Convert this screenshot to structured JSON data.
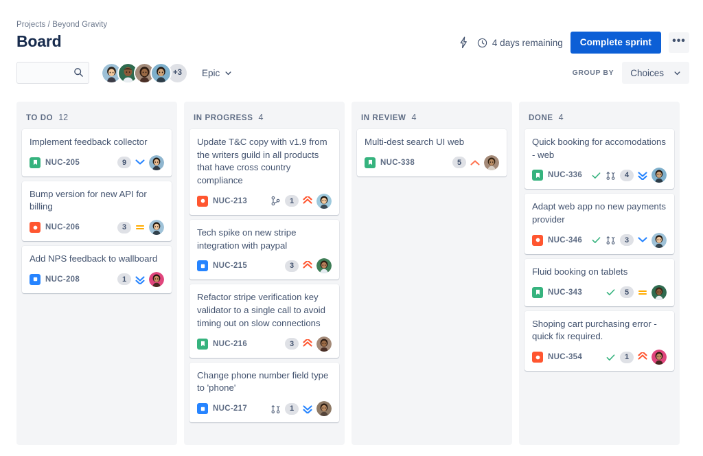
{
  "header": {
    "breadcrumb": "Projects / Beyond Gravity",
    "title": "Board",
    "lightning_icon": "lightning-bolt-icon",
    "clock_icon": "clock-icon",
    "days_remaining": "4 days remaining",
    "complete_sprint_label": "Complete sprint",
    "more_label": "•••"
  },
  "toolbar": {
    "search_placeholder": "",
    "search_value": "",
    "search_icon": "search-icon",
    "avatar_overflow": "+3",
    "epic_label": "Epic",
    "group_by_label": "GROUP BY",
    "group_by_value": "Choices"
  },
  "colors": {
    "primary": "#0c5fd6",
    "story": "#36b37e",
    "bug": "#ff5630",
    "task": "#2684ff",
    "priority_highest": "#ff5630",
    "priority_high": "#ff7452",
    "priority_medium": "#ffab00",
    "priority_low": "#2684ff",
    "priority_lowest": "#2684ff",
    "done_check": "#36b37e",
    "column_bg": "#f4f5f7"
  },
  "columns": [
    {
      "name": "TO DO",
      "count": "12",
      "cards": [
        {
          "title": "Implement feedback collector",
          "key": "NUC-205",
          "type": "story",
          "count": "9",
          "priority": "low",
          "dev": "",
          "done": false,
          "avatar": "a1"
        },
        {
          "title": "Bump version for new API for billing",
          "key": "NUC-206",
          "type": "bug",
          "count": "3",
          "priority": "medium",
          "dev": "",
          "done": false,
          "avatar": "a2"
        },
        {
          "title": "Add NPS feedback to wallboard",
          "key": "NUC-208",
          "type": "task",
          "count": "1",
          "priority": "lowest",
          "dev": "",
          "done": false,
          "avatar": "a3"
        }
      ]
    },
    {
      "name": "IN PROGRESS",
      "count": "4",
      "cards": [
        {
          "title": "Update T&C copy with v1.9 from the writers guild in all products that have cross country compliance",
          "key": "NUC-213",
          "type": "bug",
          "count": "1",
          "priority": "highest",
          "dev": "branch",
          "done": false,
          "avatar": "a4"
        },
        {
          "title": "Tech spike on new stripe integration with paypal",
          "key": "NUC-215",
          "type": "task",
          "count": "3",
          "priority": "highest",
          "dev": "",
          "done": false,
          "avatar": "a5"
        },
        {
          "title": "Refactor stripe verification key validator to a single call to avoid timing out on slow connections",
          "key": "NUC-216",
          "type": "story",
          "count": "3",
          "priority": "highest",
          "dev": "",
          "done": false,
          "avatar": "a6"
        },
        {
          "title": "Change phone number field type to 'phone'",
          "key": "NUC-217",
          "type": "task",
          "count": "1",
          "priority": "lowest",
          "dev": "pull-request",
          "done": false,
          "avatar": "a7"
        }
      ]
    },
    {
      "name": "IN REVIEW",
      "count": "4",
      "cards": [
        {
          "title": "Multi-dest search UI web",
          "key": "NUC-338",
          "type": "story",
          "count": "5",
          "priority": "high",
          "dev": "",
          "done": false,
          "avatar": "a8"
        }
      ]
    },
    {
      "name": "DONE",
      "count": "4",
      "cards": [
        {
          "title": "Quick booking for accomodations - web",
          "key": "NUC-336",
          "type": "story",
          "count": "4",
          "priority": "lowest",
          "dev": "pull-request",
          "done": true,
          "avatar": "a9"
        },
        {
          "title": "Adapt web app no new payments provider",
          "key": "NUC-346",
          "type": "bug",
          "count": "3",
          "priority": "low",
          "dev": "pull-request",
          "done": true,
          "avatar": "a10"
        },
        {
          "title": "Fluid booking on tablets",
          "key": "NUC-343",
          "type": "story",
          "count": "5",
          "priority": "medium",
          "dev": "",
          "done": true,
          "avatar": "a11"
        },
        {
          "title": "Shoping cart purchasing error - quick fix required.",
          "key": "NUC-354",
          "type": "bug",
          "count": "1",
          "priority": "highest",
          "dev": "",
          "done": true,
          "avatar": "a12"
        }
      ]
    }
  ]
}
